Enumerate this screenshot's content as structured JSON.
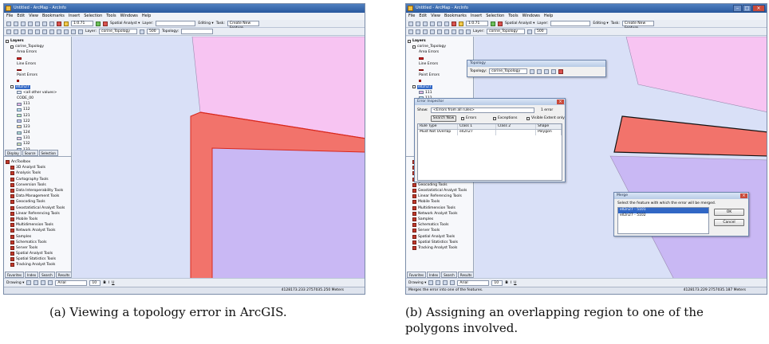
{
  "figure": {
    "caption_a": "(a) Viewing a topology error in ArcGIS.",
    "caption_b_line1": "(b) Assigning an overlapping region to one of the",
    "caption_b_line2": "polygons involved."
  },
  "shot_a": {
    "window_title": "Untitled - ArcMap - ArcInfo",
    "menu": [
      "File",
      "Edit",
      "View",
      "Bookmarks",
      "Insert",
      "Selection",
      "Tools",
      "Windows",
      "Help"
    ],
    "scale": "1:0.71",
    "spatial_analyst": "Spatial Analyst ▾",
    "layer_label": "Layer:",
    "topology_label": "Topology:",
    "editor_label": "Editing ▾",
    "task_label": "Task:",
    "task_value": "Create New Feature",
    "layer_value": "corine_Topology",
    "zoom_value": "500",
    "toc": {
      "layers_label": "Layers",
      "topology_layer": "corine_Topology",
      "area_errors": "Area Errors",
      "line_errors": "Line Errors",
      "point_errors": "Point Errors",
      "layer_name": "ell2n27",
      "all_other": "<all other values>",
      "code_header": "CODE_00",
      "codes": [
        "111",
        "112",
        "121",
        "122",
        "123",
        "124",
        "131",
        "132",
        "133"
      ]
    },
    "tabs": [
      "Display",
      "Source",
      "Selection"
    ],
    "toolbox": {
      "root": "ArcToolbox",
      "items": [
        "3D Analyst Tools",
        "Analysis Tools",
        "Cartography Tools",
        "Conversion Tools",
        "Data Interoperability Tools",
        "Data Management Tools",
        "Geocoding Tools",
        "Geostatistical Analyst Tools",
        "Linear Referencing Tools",
        "Mobile Tools",
        "Multidimension Tools",
        "Network Analyst Tools",
        "Samples",
        "Schematics Tools",
        "Server Tools",
        "Spatial Analyst Tools",
        "Spatial Statistics Tools",
        "Tracking Analyst Tools"
      ]
    },
    "bottom_tabs": [
      "Favorites",
      "Index",
      "Search",
      "Results"
    ],
    "drawing_label": "Drawing ▾",
    "font_value": "Arial",
    "font_size": "10",
    "status_text": "",
    "coords": "4128173.233  2757035.250 Meters"
  },
  "shot_b": {
    "window_title": "Untitled - ArcMap - ArcInfo",
    "topology_dialog": {
      "title": "Topology",
      "label": "Topology:",
      "value": "corine_Topology"
    },
    "error_inspector": {
      "title": "Error Inspector",
      "show_label": "Show:",
      "show_value": "<Errors from all rules>",
      "errors_count": "1 error",
      "search_now": "Search Now",
      "errors_chk": "Errors",
      "exceptions_chk": "Exceptions",
      "visible_extent": "Visible Extent only",
      "columns": [
        "Rule Type",
        "Class 1",
        "Class 2",
        "Shape"
      ],
      "row": [
        "Must Not Overlap",
        "ell2n27",
        "",
        "Polygon"
      ]
    },
    "merge_dialog": {
      "title": "Merge",
      "prompt": "Select the feature with which the error will be merged.",
      "items": [
        "ell2n27 - 5101",
        "ell2n27 - 5102"
      ],
      "ok": "OK",
      "cancel": "Cancel"
    },
    "status_text": "Merges the error into one of the features.",
    "coords": "4128173.229  2757035.187 Meters"
  },
  "colors": {
    "pink": "#f7c4f2",
    "lavender": "#c9b8f4",
    "pale_blue": "#d9e0f7",
    "error_red": "#f2736b",
    "error_edge": "#d9281e"
  }
}
